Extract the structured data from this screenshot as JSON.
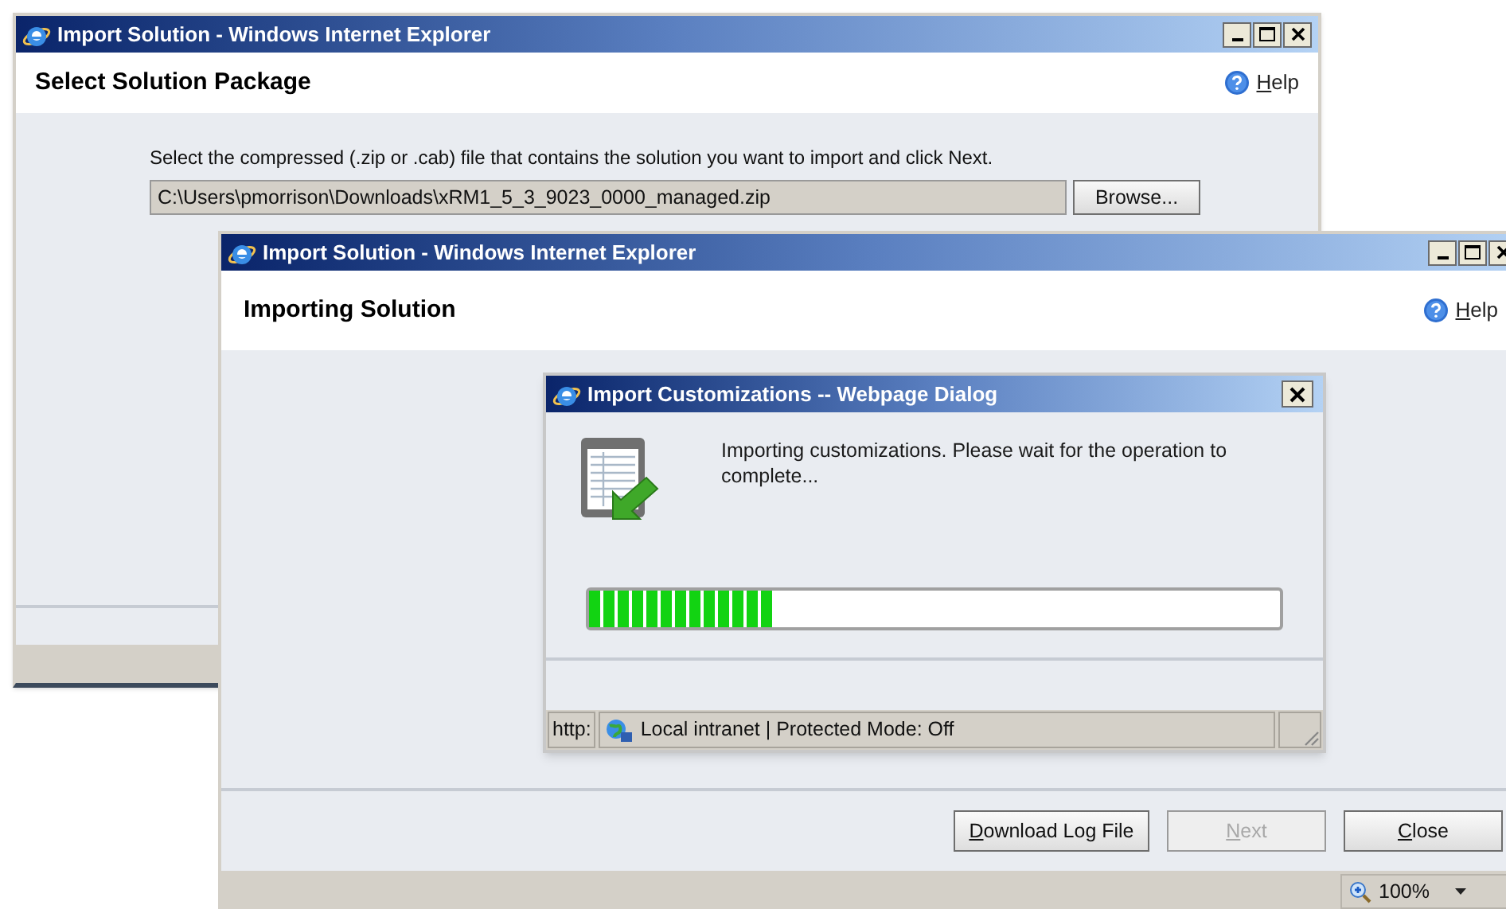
{
  "back_window": {
    "title": "Import Solution - Windows Internet Explorer",
    "heading": "Select Solution Package",
    "help": {
      "label": "Help",
      "underline_first": true
    },
    "instruction": "Select the compressed (.zip or .cab) file that contains the solution you want to import and click Next.",
    "file_path": "C:\\Users\\pmorrison\\Downloads\\xRM1_5_3_9023_0000_managed.zip",
    "browse_button": "Browse..."
  },
  "front_window": {
    "title": "Import Solution - Windows Internet Explorer",
    "heading": "Importing Solution",
    "help": {
      "label": "Help",
      "underline_first": true
    },
    "buttons": [
      {
        "label": "Download Log File",
        "underline_first": true,
        "disabled": false
      },
      {
        "label": "Next",
        "underline_first": true,
        "disabled": true
      },
      {
        "label": "Close",
        "underline_first": true,
        "disabled": false
      }
    ],
    "zoom": "100%"
  },
  "dialog": {
    "title": "Import Customizations -- Webpage Dialog",
    "message": "Importing customizations. Please wait for the operation to complete...",
    "progress": {
      "level": 0.27
    },
    "status_protocol": "http:",
    "status_zone": "Local intranet | Protected Mode: Off"
  }
}
